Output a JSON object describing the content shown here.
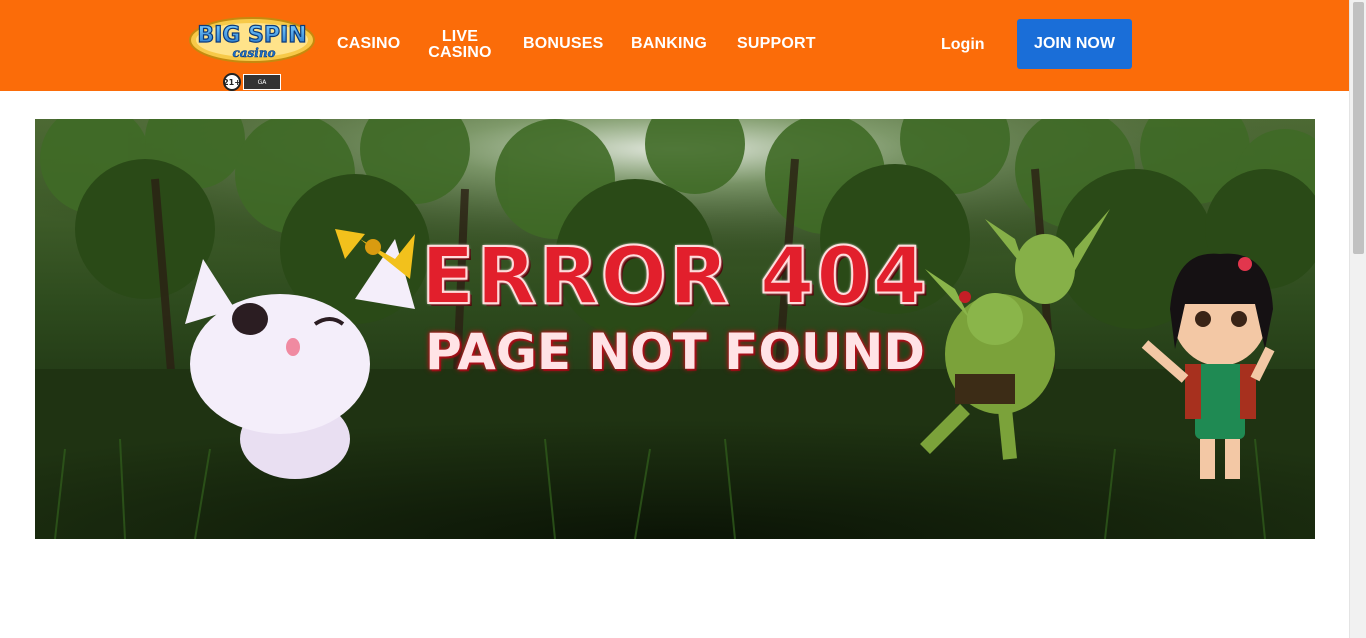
{
  "header": {
    "logo": {
      "text_main": "BIG SPIN",
      "text_sub": "casino",
      "age_badge": "21+",
      "ga_badge": "GA"
    },
    "nav": [
      {
        "id": "casino",
        "label": "CASINO"
      },
      {
        "id": "live",
        "label_line1": "LIVE",
        "label_line2": "CASINO"
      },
      {
        "id": "bonuses",
        "label": "BONUSES"
      },
      {
        "id": "banking",
        "label": "BANKING"
      },
      {
        "id": "support",
        "label": "SUPPORT"
      }
    ],
    "login_label": "Login",
    "join_label": "JOIN NOW"
  },
  "banner": {
    "title": "ERROR 404",
    "subtitle": "PAGE NOT FOUND"
  },
  "colors": {
    "header_bg": "#fb6c09",
    "join_button": "#1a6ed8",
    "error_red": "#e21f2c"
  }
}
